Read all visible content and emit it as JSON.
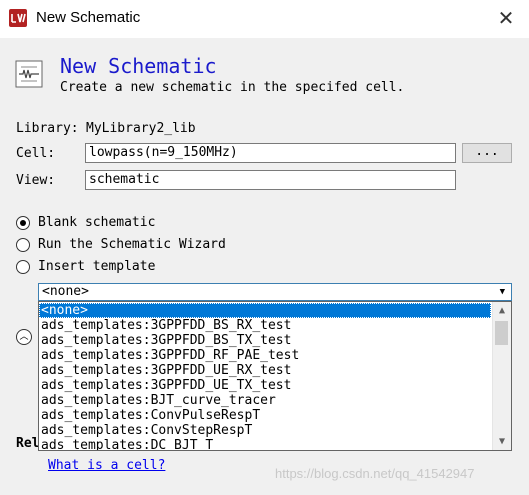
{
  "window": {
    "title": "New Schematic",
    "close_glyph": "✕",
    "app_icon": "ads-app-icon"
  },
  "header": {
    "title": "New Schematic",
    "subtitle": "Create a new schematic in the specifed cell.",
    "icon": "schematic-icon"
  },
  "form": {
    "library_label": "Library:",
    "library_value": "MyLibrary2_lib",
    "cell_label": "Cell:",
    "cell_value": "lowpass(n=9_150MHz)",
    "browse_label": "...",
    "view_label": "View:",
    "view_value": "schematic"
  },
  "options": {
    "blank": "Blank schematic",
    "wizard": "Run the Schematic Wizard",
    "template": "Insert template",
    "selected": "Blank schematic"
  },
  "template_select": {
    "value": "<none>",
    "items": [
      "<none>",
      "ads_templates:3GPPFDD_BS_RX_test",
      "ads_templates:3GPPFDD_BS_TX_test",
      "ads_templates:3GPPFDD_RF_PAE_test",
      "ads_templates:3GPPFDD_UE_RX_test",
      "ads_templates:3GPPFDD_UE_TX_test",
      "ads_templates:BJT_curve_tracer",
      "ads_templates:ConvPulseRespT",
      "ads_templates:ConvStepRespT",
      "ads_templates:DC_BJT_T"
    ],
    "highlighted_index": 0
  },
  "footer": {
    "related_label": "Rel",
    "link_text": "What is a cell?",
    "watermark": "https://blog.csdn.net/qq_41542947"
  }
}
